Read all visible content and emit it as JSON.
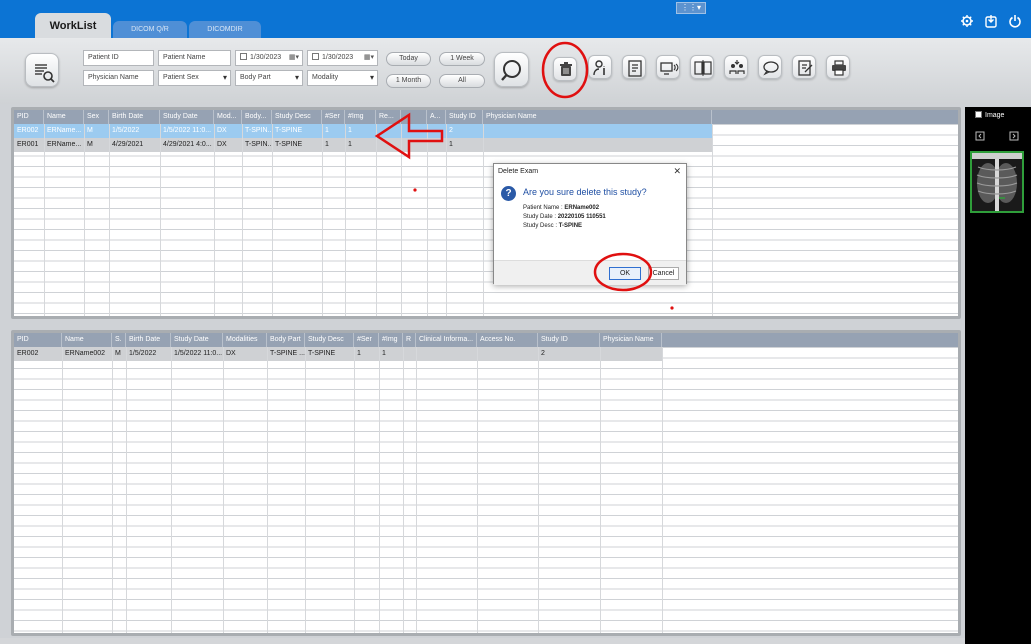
{
  "tabs": [
    {
      "label": "WorkList"
    },
    {
      "label": "DICOM Q/R"
    },
    {
      "label": "DICOMDIR"
    }
  ],
  "filters": {
    "patient_id": "Patient ID",
    "patient_name": "Patient Name",
    "date_from": "1/30/2023",
    "date_to": "1/30/2023",
    "physician_name": "Physician Name",
    "patient_sex": "Patient Sex",
    "body_part": "Body Part",
    "modality": "Modality"
  },
  "quick_dates": {
    "today": "Today",
    "one_week": "1 Week",
    "one_month": "1 Month",
    "all": "All"
  },
  "study_table": {
    "columns": [
      "PID",
      "Name",
      "Sex",
      "Birth Date",
      "Study Date",
      "Mod...",
      "Body...",
      "Study Desc",
      "#Ser",
      "#Img",
      "Re...",
      "...",
      "A...",
      "Study ID",
      "Physician Name"
    ],
    "rows": [
      [
        "ER002",
        "ERName...",
        "M",
        "1/5/2022",
        "1/5/2022 11:0...",
        "DX",
        "T-SPIN...",
        "T-SPINE",
        "1",
        "1",
        "",
        "",
        "",
        "2",
        ""
      ],
      [
        "ER001",
        "ERName...",
        "M",
        "4/29/2021",
        "4/29/2021 4:0...",
        "DX",
        "T-SPIN...",
        "T-SPINE",
        "1",
        "1",
        "",
        "",
        "",
        "1",
        ""
      ]
    ]
  },
  "series_table": {
    "columns": [
      "PID",
      "Name",
      "S.",
      "Birth Date",
      "Study Date",
      "Modalities",
      "Body Part",
      "Study Desc",
      "#Ser",
      "#Img",
      "R",
      "Clinical Informa...",
      "Access No.",
      "Study ID",
      "Physician Name"
    ],
    "rows": [
      [
        "ER002",
        "ERName002",
        "M",
        "1/5/2022",
        "1/5/2022 11:0...",
        "DX",
        "T-SPINE ...",
        "T-SPINE",
        "1",
        "1",
        "",
        "",
        "",
        "2",
        ""
      ]
    ]
  },
  "side_panel": {
    "image_label": "Image"
  },
  "dialog": {
    "title": "Delete Exam",
    "question": "Are you sure delete this study?",
    "patient_name_label": "Patient Name :",
    "patient_name_value": "ERName002",
    "study_date_label": "Study Date :",
    "study_date_value": "20220105 110551",
    "study_desc_label": "Study Desc :",
    "study_desc_value": "T-SPINE",
    "ok_label": "OK",
    "cancel_label": "Cancel"
  },
  "colors": {
    "topbar": "#0c74d4",
    "selected_row": "#9ccbf0",
    "header": "#96a2b3",
    "annotation_red": "#e01010"
  }
}
